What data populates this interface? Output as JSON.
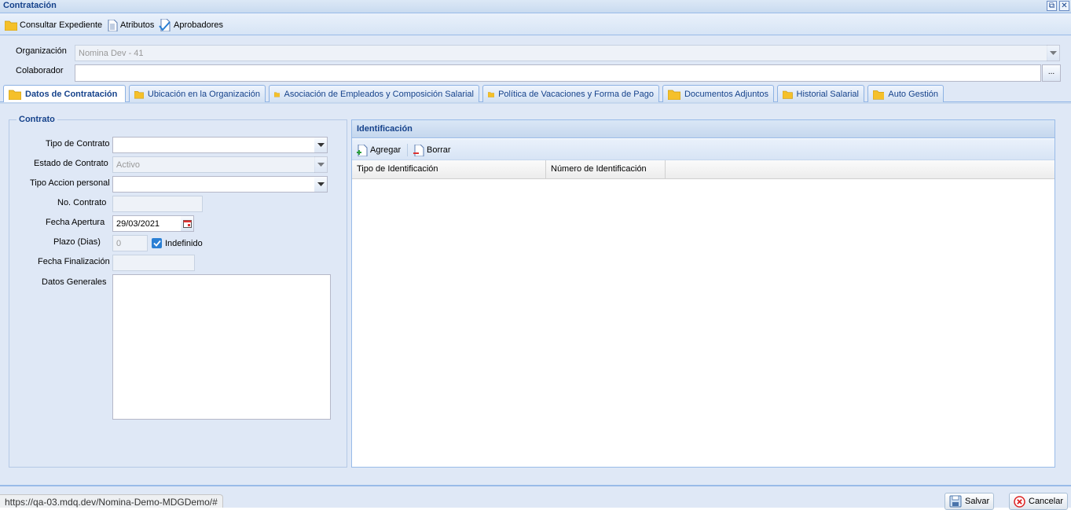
{
  "window": {
    "title": "Contratación"
  },
  "toolbar": {
    "consultar_expediente": "Consultar Expediente",
    "atributos": "Atributos",
    "aprobadores": "Aprobadores"
  },
  "header_form": {
    "organizacion_label": "Organización",
    "organizacion_value": "Nomina Dev - 41",
    "colaborador_label": "Colaborador",
    "colaborador_value": "",
    "colaborador_button": "..."
  },
  "tabs": [
    {
      "label": "Datos de Contratación",
      "active": true
    },
    {
      "label": "Ubicación en la Organización"
    },
    {
      "label": "Asociación de Empleados y Composición Salarial"
    },
    {
      "label": "Política de Vacaciones y Forma de Pago"
    },
    {
      "label": "Documentos Adjuntos"
    },
    {
      "label": "Historial Salarial"
    },
    {
      "label": "Auto Gestión"
    }
  ],
  "contrato": {
    "legend": "Contrato",
    "tipo_contrato_label": "Tipo de Contrato",
    "tipo_contrato_value": "",
    "estado_contrato_label": "Estado de Contrato",
    "estado_contrato_value": "Activo",
    "tipo_accion_label": "Tipo Accion personal",
    "tipo_accion_value": "",
    "no_contrato_label": "No. Contrato",
    "no_contrato_value": "",
    "fecha_apertura_label": "Fecha Apertura",
    "fecha_apertura_value": "29/03/2021",
    "plazo_label": "Plazo (Dias)",
    "plazo_value": "0",
    "indefinido_label": "Indefinido",
    "indefinido_checked": true,
    "fecha_finalizacion_label": "Fecha Finalización",
    "fecha_finalizacion_value": "",
    "datos_generales_label": "Datos Generales",
    "datos_generales_value": ""
  },
  "identificacion": {
    "title": "Identificación",
    "agregar": "Agregar",
    "borrar": "Borrar",
    "columns": [
      "Tipo de Identificación",
      "Número de Identificación"
    ],
    "rows": []
  },
  "footer": {
    "status_url": "https://qa-03.mdq.dev/Nomina-Demo-MDGDemo/#",
    "salvar": "Salvar",
    "cancelar": "Cancelar"
  },
  "colors": {
    "header_text": "#15428b",
    "panel_bg": "#dfe8f6",
    "border": "#99bbe8",
    "folder": "#f5c02a"
  }
}
